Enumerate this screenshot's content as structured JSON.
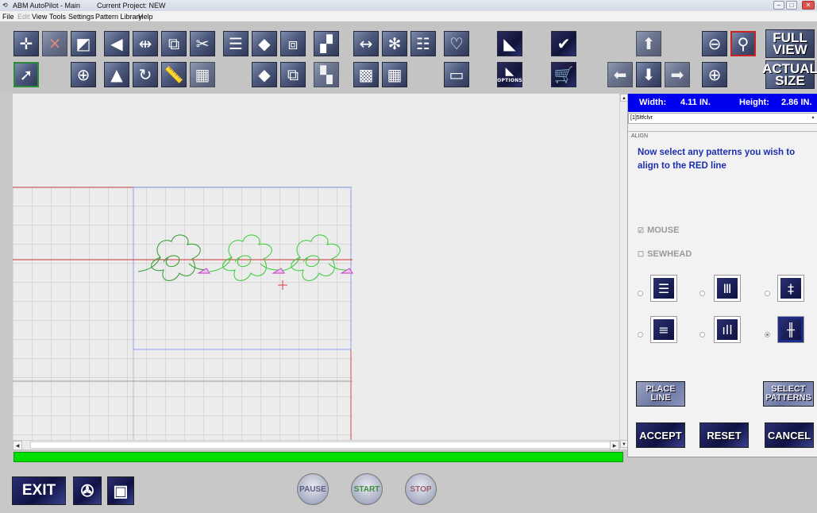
{
  "window": {
    "title": "ABM AutoPilot - Main",
    "project": "Current Project: NEW",
    "icon": "app-icon",
    "minimize": "–",
    "maximize": "□",
    "close": "✕"
  },
  "menu": {
    "file": "File",
    "edit": "Edit",
    "view": "View",
    "tools": "Tools",
    "settings": "Settings",
    "library": "Pattern Library",
    "help": "Help"
  },
  "toolbar": {
    "full_view": "FULL VIEW",
    "full_view_1": "FULL",
    "full_view_2": "VIEW",
    "actual_size_1": "ACTUAL",
    "actual_size_2": "SIZE",
    "options": "OPTIONS"
  },
  "panel": {
    "width_label": "Width:",
    "width_value": "4.11 IN.",
    "height_label": "Height:",
    "height_value": "2.86 IN.",
    "pattern_combo": "[1]5ltfclvr",
    "section_label": "ALIGN",
    "instruction": "Now select any patterns you wish to align to the RED line",
    "mouse_label": "MOUSE",
    "sewhead_label": "SEWHEAD",
    "mouse_checked": true,
    "sewhead_checked": false,
    "align_selected": 6,
    "place_line_1": "PLACE",
    "place_line_2": "LINE",
    "select_patterns_1": "SELECT",
    "select_patterns_2": "PATTERNS",
    "accept": "ACCEPT",
    "reset": "RESET",
    "cancel": "CANCEL"
  },
  "bottom": {
    "exit": "EXIT",
    "pause": "PAUSE",
    "start": "START",
    "stop": "STOP"
  },
  "colors": {
    "dims_bar": "#0000f0",
    "instruction_text": "#1b2fb0",
    "progress": "#00e000",
    "red_line": "#d03030",
    "pattern_selected": "#2a9a2a",
    "pattern_preview": "#33cc33",
    "marker": "#c040c0",
    "blue_frame": "#8c9ef0"
  },
  "progress": 1.0
}
